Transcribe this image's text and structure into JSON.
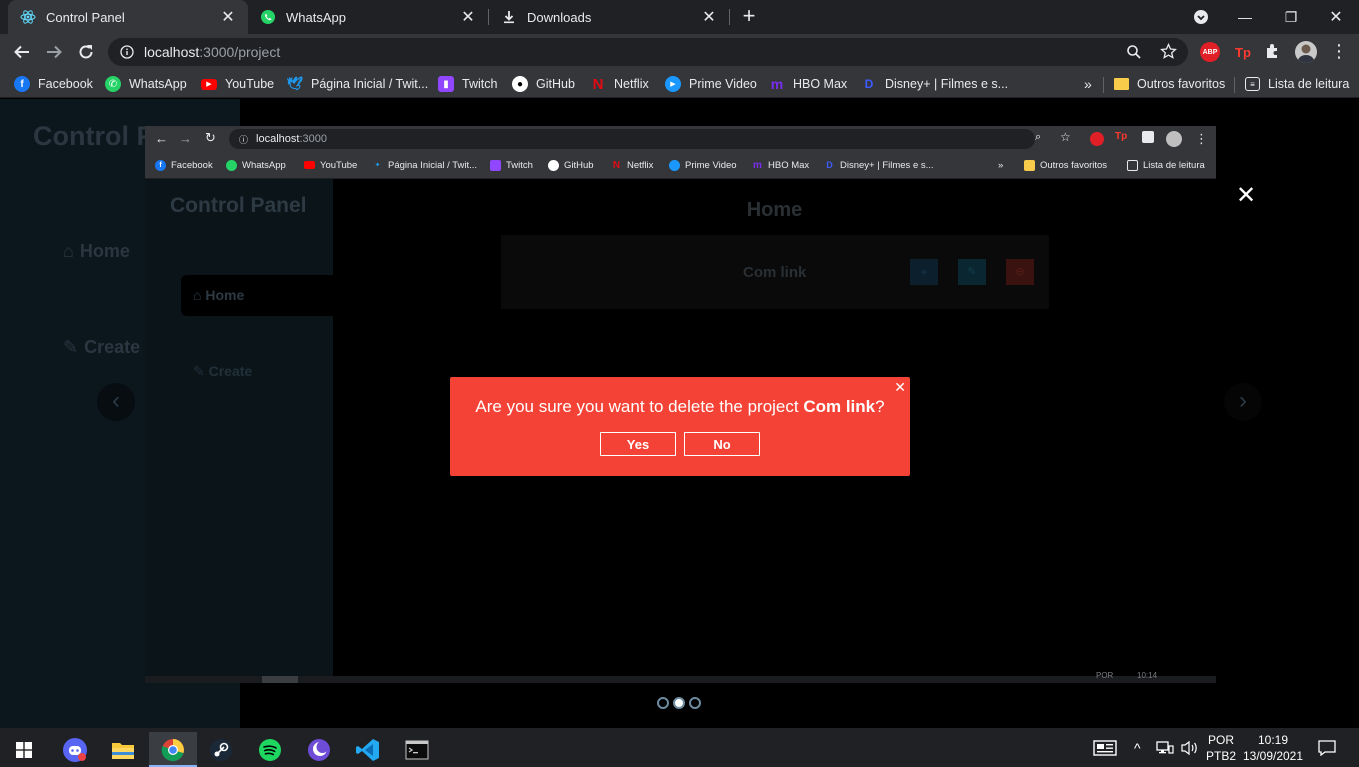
{
  "browser": {
    "tabs": [
      {
        "title": "Control Panel",
        "icon": "react-icon",
        "active": true
      },
      {
        "title": "WhatsApp",
        "icon": "whatsapp-icon",
        "active": false
      },
      {
        "title": "Downloads",
        "icon": "download-icon",
        "active": false
      }
    ],
    "url_host": "localhost",
    "url_path": ":3000/project",
    "bookmarks": [
      {
        "label": "Facebook",
        "icon": "facebook-icon",
        "color": "#1877f2"
      },
      {
        "label": "WhatsApp",
        "icon": "whatsapp-icon",
        "color": "#25d366"
      },
      {
        "label": "YouTube",
        "icon": "youtube-icon",
        "color": "#ff0000"
      },
      {
        "label": "Página Inicial / Twit...",
        "icon": "twitter-icon",
        "color": "#1d9bf0"
      },
      {
        "label": "Twitch",
        "icon": "twitch-icon",
        "color": "#9146ff"
      },
      {
        "label": "GitHub",
        "icon": "github-icon",
        "color": "#ffffff"
      },
      {
        "label": "Netflix",
        "icon": "netflix-icon",
        "color": "#e50914"
      },
      {
        "label": "Prime Video",
        "icon": "prime-video-icon",
        "color": "#1a98ff"
      },
      {
        "label": "HBO Max",
        "icon": "hbo-max-icon",
        "color": "#7a2cf0"
      },
      {
        "label": "Disney+ | Filmes e s...",
        "icon": "disney-plus-icon",
        "color": "#1d3fcc"
      }
    ],
    "overflow_label": "»",
    "other_favorites": "Outros favoritos",
    "reading_list": "Lista de leitura",
    "extensions": [
      "ABP",
      "Tp"
    ]
  },
  "background_app": {
    "title": "Control P",
    "nav": [
      {
        "label": "Home"
      },
      {
        "label": "Create"
      }
    ]
  },
  "lightbox": {
    "close_label": "✕",
    "prev_label": "‹",
    "next_label": "›",
    "dots_count": 3,
    "active_dot": 1
  },
  "screenshot": {
    "url_host": "localhost",
    "url_path": ":3000",
    "bookmarks": [
      {
        "label": "Facebook",
        "color": "#1877f2"
      },
      {
        "label": "WhatsApp",
        "color": "#25d366"
      },
      {
        "label": "YouTube",
        "color": "#ff0000"
      },
      {
        "label": "Página Inicial / Twit...",
        "color": "#1d9bf0"
      },
      {
        "label": "Twitch",
        "color": "#9146ff"
      },
      {
        "label": "GitHub",
        "color": "#ffffff"
      },
      {
        "label": "Netflix",
        "color": "#e50914"
      },
      {
        "label": "Prime Video",
        "color": "#1a98ff"
      },
      {
        "label": "HBO Max",
        "color": "#7a2cf0"
      },
      {
        "label": "Disney+ | Filmes e s...",
        "color": "#1d3fcc"
      }
    ],
    "overflow_label": "»",
    "other_favorites": "Outros favoritos",
    "reading_list": "Lista de leitura",
    "app_title": "Control Panel",
    "nav_home": "Home",
    "nav_create": "Create",
    "page_heading": "Home",
    "project_name": "Com link",
    "taskbar_lang": "POR",
    "taskbar_time": "10:14"
  },
  "dialog": {
    "message_prefix": "Are you sure you want to delete the project ",
    "project_name": "Com link",
    "message_suffix": "?",
    "yes_label": "Yes",
    "no_label": "No",
    "close_label": "✕",
    "color": "#f44336"
  },
  "taskbar": {
    "apps": [
      "windows-start-icon",
      "discord-icon",
      "file-explorer-icon",
      "chrome-icon",
      "steam-icon",
      "spotify-icon",
      "moon-app-icon",
      "vscode-icon",
      "terminal-icon"
    ],
    "lang_top": "POR",
    "lang_bottom": "PTB2",
    "time": "10:19",
    "date": "13/09/2021"
  }
}
